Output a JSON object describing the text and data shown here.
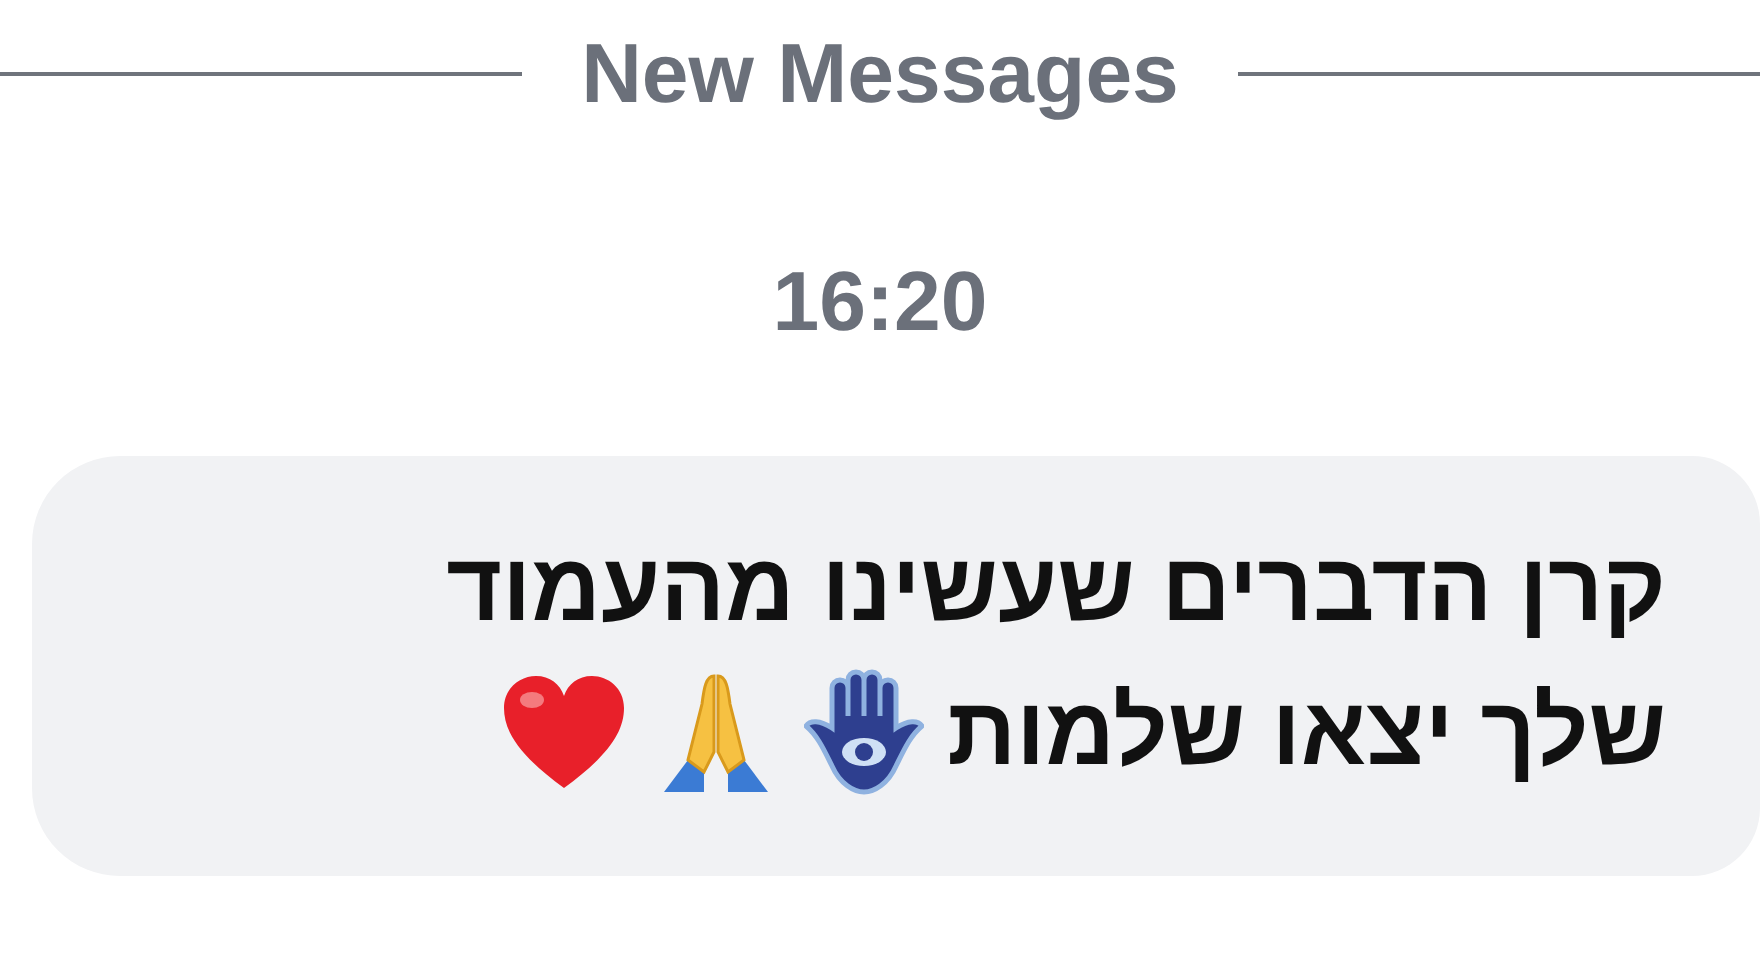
{
  "divider": {
    "label": "New Messages"
  },
  "timestamp": "16:20",
  "message": {
    "lines": [
      "קרן הדברים שעשינו מהעמוד",
      "שלך יצאו שלמות"
    ],
    "reactions": [
      {
        "kind": "hamsa"
      },
      {
        "kind": "praying-hands"
      },
      {
        "kind": "heart"
      }
    ]
  }
}
